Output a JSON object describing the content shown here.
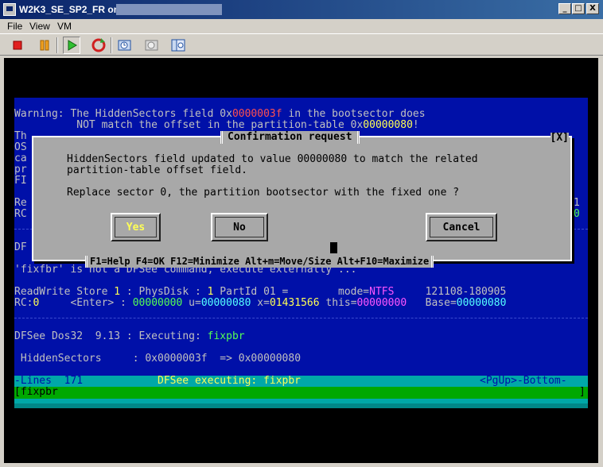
{
  "window": {
    "title": "W2K3_SE_SP2_FR on",
    "minimize": "_",
    "maximize": "□",
    "close": "X"
  },
  "menu": {
    "file": "File",
    "view": "View",
    "vm": "VM"
  },
  "toolbar_icons": [
    "stop-icon",
    "pause-icon",
    "play-icon",
    "reset-icon",
    "snapshot-icon",
    "revert-snapshot-icon",
    "manage-snapshots-icon"
  ],
  "console": {
    "warning1_pre": "Warning: The HiddenSectors field 0x",
    "warning1_val": "0000003f",
    "warning1_post": " in the bootsector does",
    "warning2_pre": "          NOT match the offset in the partition-table 0x",
    "warning2_val": "00000080",
    "warning2_post": "!",
    "left_chars": [
      "Th",
      "OS",
      "ca",
      "pr",
      "FI",
      "",
      "Re",
      "RC",
      "",
      "",
      "DF"
    ],
    "right_chars": [
      "1",
      "0"
    ],
    "error_line": "'fixfbr' is not a DFSee command, execute externally ...",
    "status1": {
      "a": "ReadWrite Store ",
      "b": "1",
      "c": " : PhysDisk : ",
      "d": "1",
      "e": " PartId 01 =        mode=",
      "f": "NTFS",
      "g": "     121108-180905"
    },
    "status2": {
      "a": "RC:",
      "b": "0",
      "c": "     <Enter> : ",
      "d": "00000000",
      "e": " u=",
      "f": "00000080",
      "g": " x=",
      "h": "01431566",
      "i": " this=",
      "j": "00000000",
      "k": "   Base=",
      "l": "00000080"
    },
    "exec_pre": "DFSee Dos32  9.13 : Executing: ",
    "exec_cmd": "fixpbr",
    "hidden_label": " HiddenSectors     : 0x0000003f  => 0x00000080",
    "statusbar_left": "-Lines  171",
    "statusbar_mid": "DFSee executing: fixpbr",
    "statusbar_right": "<PgUp>-Bottom-",
    "cmd_text": "[fixpbr",
    "cmd_end": "]"
  },
  "dialog": {
    "title": "Confirmation request",
    "close": "[X]",
    "line1": "HiddenSectors field updated to value 00000080 to match the related",
    "line2": "partition-table offset field.",
    "line3": "Replace sector 0, the partition bootsector with the fixed one ?",
    "yes": "Yes",
    "no": "No",
    "cancel": "Cancel",
    "help": "F1=Help F4=OK F12=Minimize Alt+m=Move/Size Alt+F10=Maximize"
  }
}
